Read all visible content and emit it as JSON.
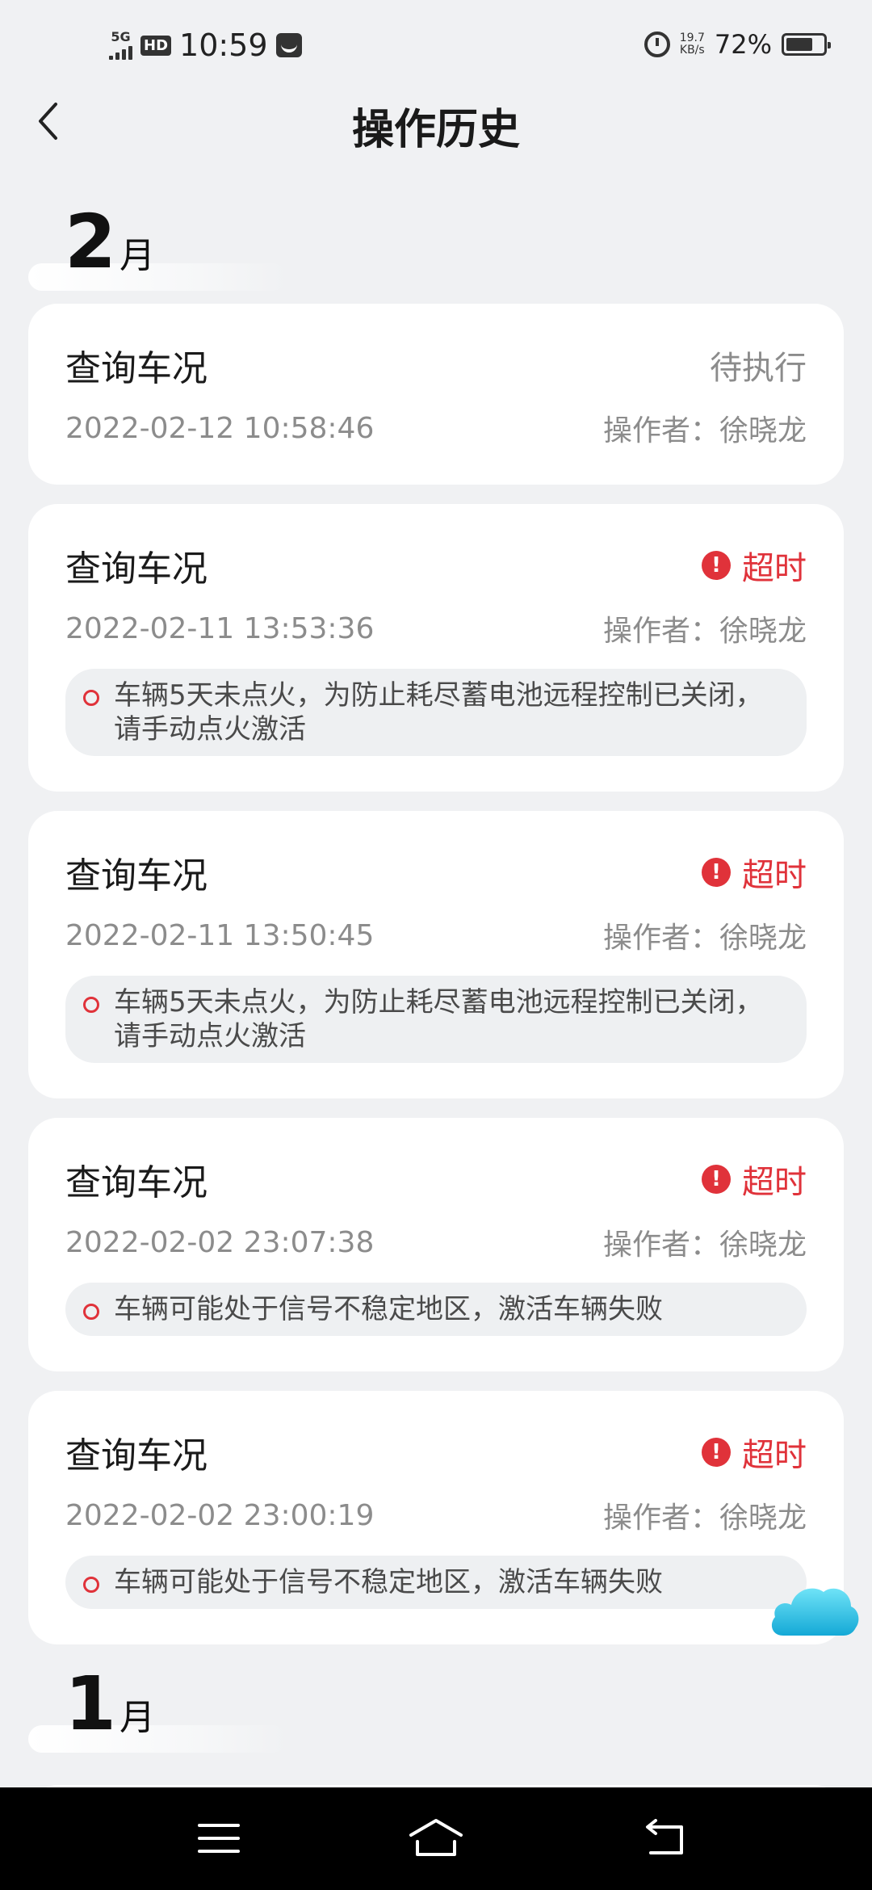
{
  "status_bar": {
    "network": "5G",
    "hd": "HD",
    "time": "10:59",
    "speed_value": "19.7",
    "speed_unit": "KB/s",
    "battery_pct": "72%",
    "battery_level": 0.72
  },
  "header": {
    "title": "操作历史"
  },
  "months": [
    {
      "num": "2",
      "unit": "月",
      "records": [
        {
          "title": "查询车况",
          "status": "待执行",
          "status_type": "pending",
          "time": "2022-02-12 10:58:46",
          "operator": "操作者：徐晓龙",
          "message": ""
        },
        {
          "title": "查询车况",
          "status": "超时",
          "status_type": "timeout",
          "time": "2022-02-11 13:53:36",
          "operator": "操作者：徐晓龙",
          "message": "车辆5天未点火，为防止耗尽蓄电池远程控制已关闭，请手动点火激活"
        },
        {
          "title": "查询车况",
          "status": "超时",
          "status_type": "timeout",
          "time": "2022-02-11 13:50:45",
          "operator": "操作者：徐晓龙",
          "message": "车辆5天未点火，为防止耗尽蓄电池远程控制已关闭，请手动点火激活"
        },
        {
          "title": "查询车况",
          "status": "超时",
          "status_type": "timeout",
          "time": "2022-02-02 23:07:38",
          "operator": "操作者：徐晓龙",
          "message": "车辆可能处于信号不稳定地区，激活车辆失败"
        },
        {
          "title": "查询车况",
          "status": "超时",
          "status_type": "timeout",
          "time": "2022-02-02 23:00:19",
          "operator": "操作者：徐晓龙",
          "message": "车辆可能处于信号不稳定地区，激活车辆失败"
        }
      ]
    },
    {
      "num": "1",
      "unit": "月",
      "records": []
    }
  ],
  "colors": {
    "accent_red": "#e0323a",
    "background": "#f0f1f3",
    "card": "#ffffff",
    "muted_text": "#8c8c8c"
  },
  "icons": {
    "back": "chevron-left-icon",
    "warning": "exclamation-circle-icon",
    "cloud": "cloud-icon",
    "nav_menu": "menu-icon",
    "nav_home": "home-icon",
    "nav_back": "back-icon"
  }
}
